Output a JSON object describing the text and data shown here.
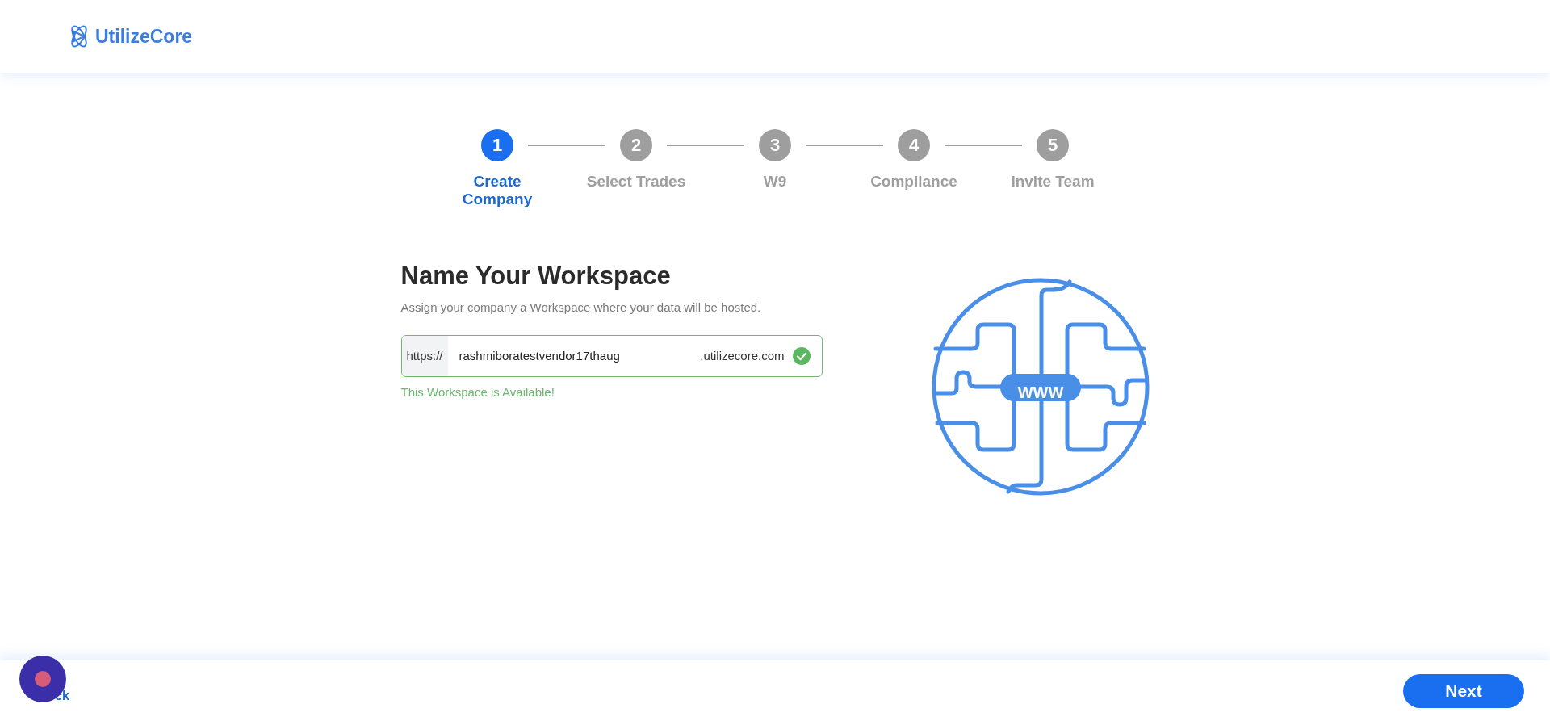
{
  "header": {
    "logo_text": "UtilizeCore"
  },
  "steps": [
    {
      "number": "1",
      "label": "Create Company",
      "selected": true
    },
    {
      "number": "2",
      "label": "Select Trades",
      "selected": false
    },
    {
      "number": "3",
      "label": "W9",
      "selected": false
    },
    {
      "number": "4",
      "label": "Compliance",
      "selected": false
    },
    {
      "number": "5",
      "label": "Invite Team",
      "selected": false
    }
  ],
  "form": {
    "title": "Name Your Workspace",
    "subtitle": "Assign your company a Workspace where your data will be hosted.",
    "field": {
      "prefix": "https://",
      "value": "rashmiboratestvendor17thaug",
      "suffix": ".utilizecore.com",
      "available": true
    },
    "message": "This Workspace is Available!"
  },
  "illustration": {
    "label": "WWW"
  },
  "footer": {
    "back_link": "ck",
    "next_button": "Next"
  }
}
